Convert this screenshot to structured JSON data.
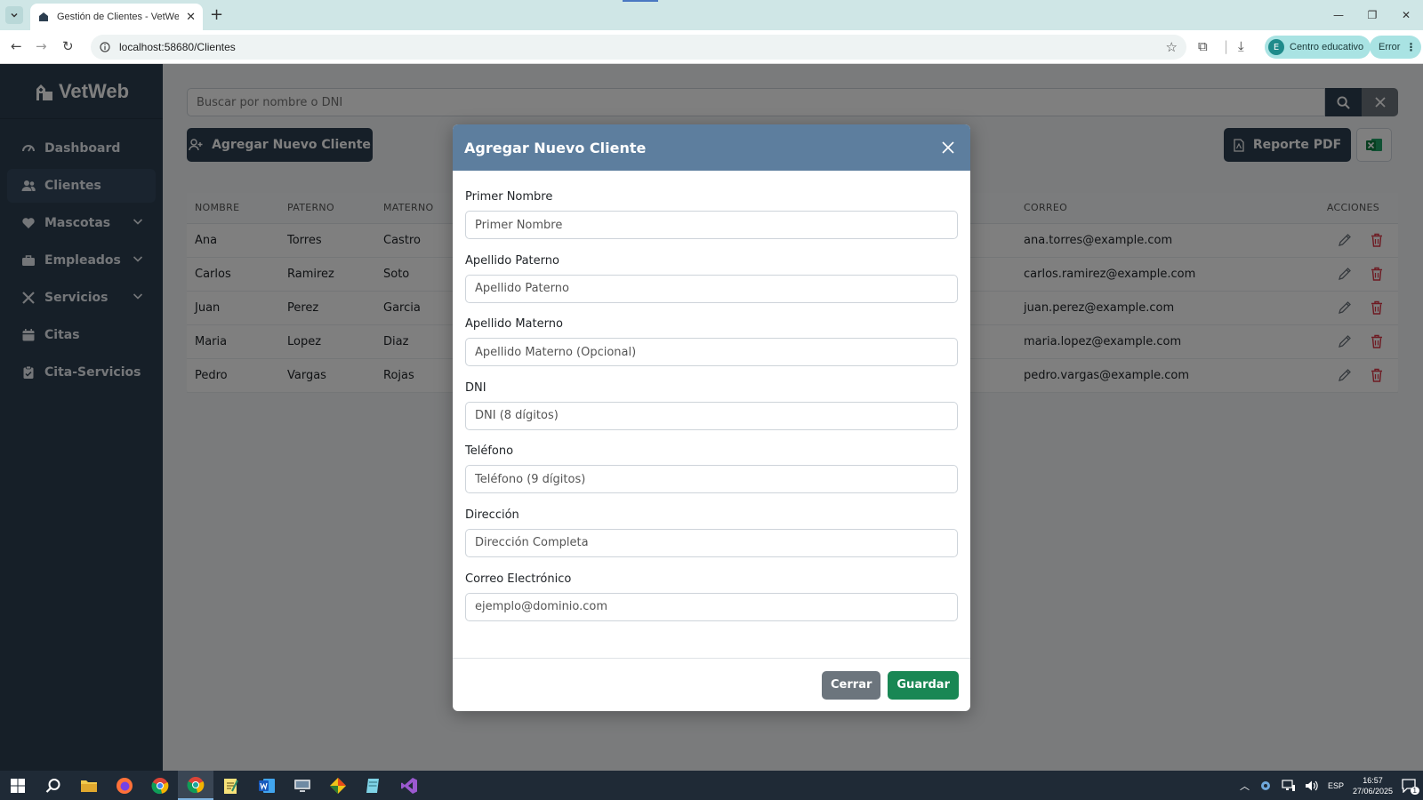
{
  "browser": {
    "tab_title": "Gestión de Clientes - VetWeb",
    "url": "localhost:58680/Clientes",
    "profile_initial": "E",
    "profile_label": "Centro educativo",
    "error_label": "Error"
  },
  "sidebar": {
    "brand": "VetWeb",
    "items": [
      {
        "label": "Dashboard",
        "icon": "dashboard-icon",
        "expandable": false
      },
      {
        "label": "Clientes",
        "icon": "users-icon",
        "expandable": false,
        "active": true
      },
      {
        "label": "Mascotas",
        "icon": "heart-icon",
        "expandable": true
      },
      {
        "label": "Empleados",
        "icon": "briefcase-icon",
        "expandable": true
      },
      {
        "label": "Servicios",
        "icon": "tools-icon",
        "expandable": true
      },
      {
        "label": "Citas",
        "icon": "calendar-icon",
        "expandable": false
      },
      {
        "label": "Cita-Servicios",
        "icon": "clipboard-icon",
        "expandable": false
      }
    ]
  },
  "main": {
    "search_placeholder": "Buscar por nombre o DNI",
    "add_button": "Agregar Nuevo Cliente",
    "pdf_button": "Reporte PDF",
    "table": {
      "headers": [
        "NOMBRE",
        "PATERNO",
        "MATERNO",
        "CORREO",
        "ACCIONES"
      ],
      "rows": [
        [
          "Ana",
          "Torres",
          "Castro",
          "ana.torres@example.com"
        ],
        [
          "Carlos",
          "Ramirez",
          "Soto",
          "carlos.ramirez@example.com"
        ],
        [
          "Juan",
          "Perez",
          "Garcia",
          "juan.perez@example.com"
        ],
        [
          "Maria",
          "Lopez",
          "Diaz",
          "maria.lopez@example.com"
        ],
        [
          "Pedro",
          "Vargas",
          "Rojas",
          "pedro.vargas@example.com"
        ]
      ]
    }
  },
  "modal": {
    "title": "Agregar Nuevo Cliente",
    "fields": [
      {
        "label": "Primer Nombre",
        "placeholder": "Primer Nombre",
        "value": ""
      },
      {
        "label": "Apellido Paterno",
        "placeholder": "Apellido Paterno",
        "value": ""
      },
      {
        "label": "Apellido Materno",
        "placeholder": "Apellido Materno (Opcional)",
        "value": ""
      },
      {
        "label": "DNI",
        "placeholder": "DNI (8 dígitos)",
        "value": ""
      },
      {
        "label": "Teléfono",
        "placeholder": "Teléfono (9 dígitos)",
        "value": ""
      },
      {
        "label": "Dirección",
        "placeholder": "Dirección Completa",
        "value": ""
      },
      {
        "label": "Correo Electrónico",
        "placeholder": "ejemplo@dominio.com",
        "value": ""
      }
    ],
    "close_button": "Cerrar",
    "save_button": "Guardar"
  },
  "taskbar": {
    "language": "ESP",
    "time": "16:57",
    "date": "27/06/2025",
    "notification_count": "1"
  },
  "colors": {
    "sidebar_bg": "#2c3e50",
    "modal_header": "#5d7e9e",
    "save_green": "#198754",
    "delete_red": "#dc3545"
  }
}
